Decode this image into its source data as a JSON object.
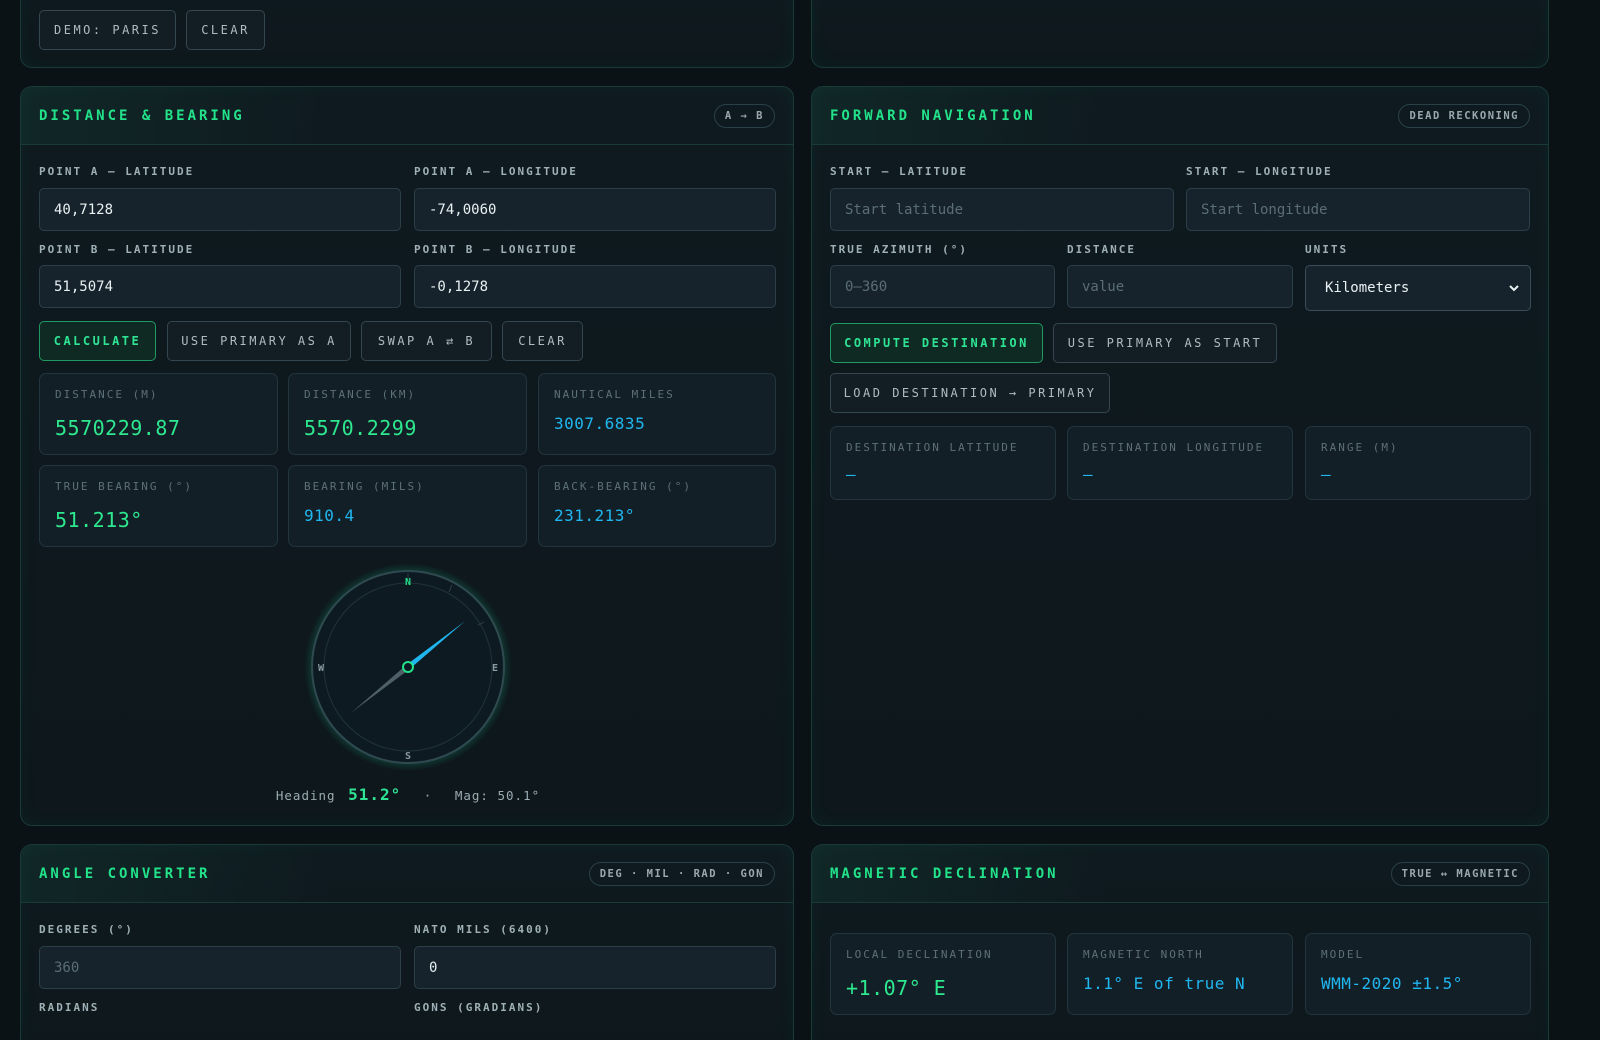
{
  "top": {
    "demo_label": "DEMO: PARIS",
    "clear_label": "CLEAR"
  },
  "distance": {
    "title": "DISTANCE & BEARING",
    "badge": "A → B",
    "a_lat_label": "POINT A — LATITUDE",
    "a_lon_label": "POINT A — LONGITUDE",
    "b_lat_label": "POINT B — LATITUDE",
    "b_lon_label": "POINT B — LONGITUDE",
    "a_lat": "40,7128",
    "a_lon": "-74,0060",
    "b_lat": "51,5074",
    "b_lon": "-0,1278",
    "buttons": {
      "calculate": "CALCULATE",
      "use_primary": "USE PRIMARY AS A",
      "swap": "SWAP A ⇄ B",
      "clear": "CLEAR"
    },
    "results": [
      {
        "label": "DISTANCE (M)",
        "value": "5570229.87"
      },
      {
        "label": "DISTANCE (KM)",
        "value": "5570.2299"
      },
      {
        "label": "NAUTICAL MILES",
        "value": "3007.6835"
      },
      {
        "label": "TRUE BEARING (°)",
        "value": "51.213°"
      },
      {
        "label": "BEARING (MILS)",
        "value": "910.4"
      },
      {
        "label": "BACK-BEARING (°)",
        "value": "231.213°"
      }
    ],
    "compass": {
      "n": "N",
      "e": "E",
      "s": "S",
      "w": "W",
      "heading_deg": 51.2,
      "heading_label": "Heading",
      "heading_value": "51.2°",
      "sep": "·",
      "mag_text": "Mag: 50.1°"
    }
  },
  "forward": {
    "title": "FORWARD NAVIGATION",
    "badge": "DEAD RECKONING",
    "start_lat_label": "START — LATITUDE",
    "start_lon_label": "START — LONGITUDE",
    "start_lat_ph": "Start latitude",
    "start_lon_ph": "Start longitude",
    "azimuth_label": "TRUE AZIMUTH (°)",
    "distance_label": "DISTANCE",
    "units_label": "UNITS",
    "azimuth_ph": "0–360",
    "distance_ph": "value",
    "units_value": "Kilometers",
    "compute": "COMPUTE DESTINATION",
    "use_primary_start": "USE PRIMARY AS START",
    "load_dest": "LOAD DESTINATION → PRIMARY",
    "results": [
      {
        "label": "DESTINATION LATITUDE",
        "value": "—"
      },
      {
        "label": "DESTINATION LONGITUDE",
        "value": "—"
      },
      {
        "label": "RANGE (M)",
        "value": "—"
      }
    ]
  },
  "angle": {
    "title": "ANGLE CONVERTER",
    "badge": "DEG · MIL · RAD · GON",
    "degrees_label": "DEGREES (°)",
    "mils_label": "NATO MILS (6400)",
    "degrees_ph": "360",
    "mils_value": "0",
    "radians_label": "RADIANS",
    "gons_label": "GONS (GRADIANS)"
  },
  "magnetic": {
    "title": "MAGNETIC DECLINATION",
    "badge": "TRUE ↔ MAGNETIC",
    "results": [
      {
        "label": "LOCAL DECLINATION",
        "value": "+1.07° E"
      },
      {
        "label": "MAGNETIC NORTH",
        "value": "1.1° E of true N"
      },
      {
        "label": "MODEL",
        "value": "WMM-2020 ±1.5°"
      }
    ]
  }
}
